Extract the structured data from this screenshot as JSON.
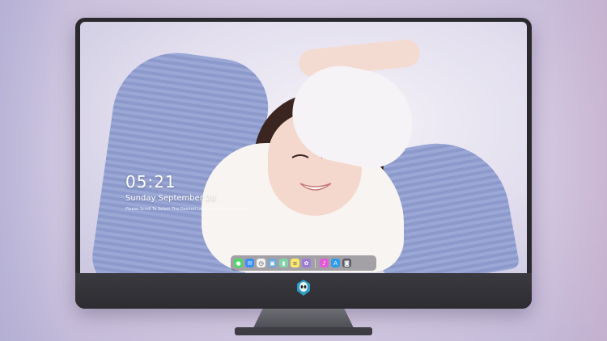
{
  "lock_screen": {
    "time": "05:21",
    "date": "Sunday September 28",
    "subtitle": "Please Scroll To Select The Desired Location For Your Desktop"
  },
  "dock": {
    "apps": [
      {
        "name": "messages-icon",
        "color": "#4cd964",
        "glyph": "●"
      },
      {
        "name": "mail-icon",
        "color": "#3a8ef6",
        "glyph": "✉"
      },
      {
        "name": "clock-icon",
        "color": "#f2f2f2",
        "glyph": "◷"
      },
      {
        "name": "preview-icon",
        "color": "#6fa8dc",
        "glyph": "▣"
      },
      {
        "name": "claquette-icon",
        "color": "#7fd3a8",
        "glyph": "▮"
      },
      {
        "name": "notes-icon",
        "color": "#fde86b",
        "glyph": "≡"
      },
      {
        "name": "photos-icon",
        "color": "#9b7bd8",
        "glyph": "✿"
      },
      {
        "name": "itunes-icon",
        "color": "#e25ad6",
        "glyph": "♪"
      },
      {
        "name": "app-store-icon",
        "color": "#2d9cf0",
        "glyph": "A"
      },
      {
        "name": "screenshot-icon",
        "color": "#5b5b66",
        "glyph": "◙"
      }
    ]
  },
  "monitor": {
    "logo": "alien-logo-icon"
  }
}
